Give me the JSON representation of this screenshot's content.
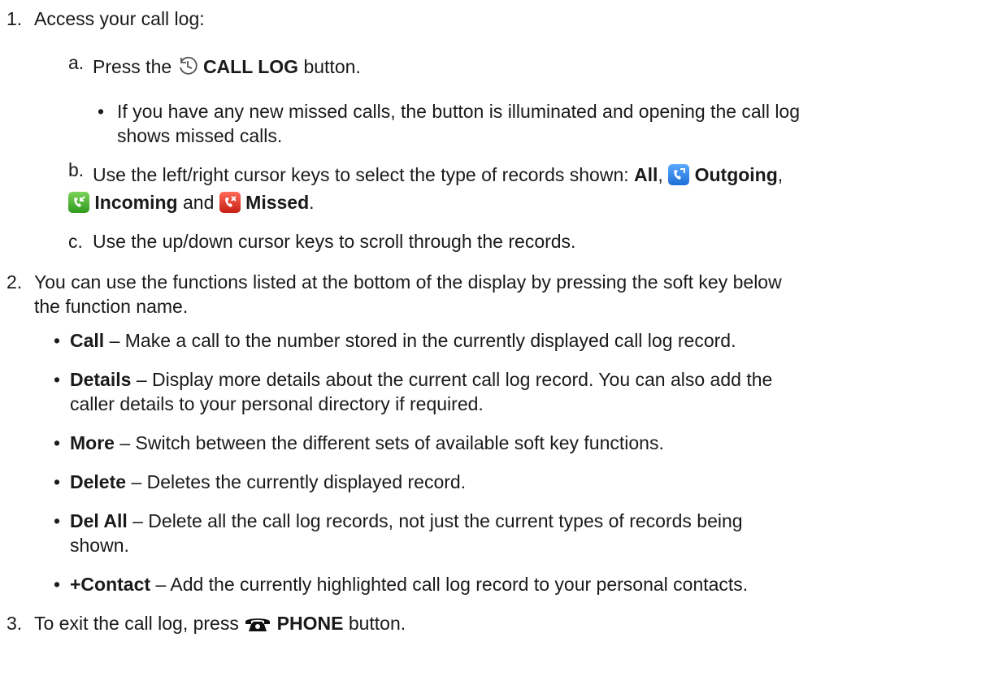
{
  "steps": {
    "s1": {
      "num": "1.",
      "text": "Access your call log:"
    },
    "a": {
      "label": "a.",
      "pre": "Press the",
      "bold": "CALL LOG",
      "post": "button."
    },
    "a_note1": "If you have any new missed calls, the button is illuminated and opening the call log",
    "a_note2": "shows missed calls.",
    "b": {
      "label": "b.",
      "pre": "Use the left/right cursor keys to select the type of records shown:",
      "all": "All",
      "outgoing": "Outgoing",
      "incoming": "Incoming",
      "and": "and",
      "missed": "Missed"
    },
    "c": {
      "label": "c.",
      "text": "Use the up/down cursor keys to scroll through the records."
    },
    "s2": {
      "num": "2.",
      "line1": "You can use the functions listed at the bottom of the display by pressing the soft key below",
      "line2": "the function name."
    },
    "functions": [
      {
        "name": "Call",
        "line1": "– Make a call to the number stored in the currently displayed call log record.",
        "line2": ""
      },
      {
        "name": "Details",
        "line1": "– Display more details about the current call log record. You can also add the",
        "line2": "caller details to your personal directory if required."
      },
      {
        "name": "More",
        "line1": "– Switch between the different sets of available soft key functions.",
        "line2": ""
      },
      {
        "name": "Delete",
        "line1": "– Deletes the currently displayed record.",
        "line2": ""
      },
      {
        "name": "Del All",
        "line1": "– Delete all the call log records, not just the current types of records being",
        "line2": "shown."
      },
      {
        "name": "+Contact",
        "line1": "– Add the currently highlighted call log record to your personal contacts.",
        "line2": ""
      }
    ],
    "s3": {
      "num": "3.",
      "pre": "To exit the call log, press",
      "bold": "PHONE",
      "post": "button."
    }
  },
  "icons": {
    "call_log": "clock-icon",
    "outgoing": "outgoing-call-icon",
    "incoming": "incoming-call-icon",
    "missed": "missed-call-icon",
    "phone": "phone-icon"
  },
  "colors": {
    "outgoing": "#1c6fd6",
    "incoming": "#2f9a1c",
    "missed": "#c41f12",
    "text": "#1a1a1a"
  }
}
